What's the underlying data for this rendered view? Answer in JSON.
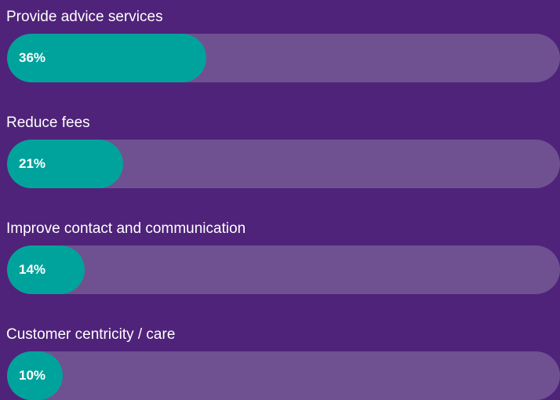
{
  "colors": {
    "background": "#4f237a",
    "track": "#6f5192",
    "bar": "#00a39b",
    "text": "#ffffff"
  },
  "chart_data": {
    "type": "bar",
    "orientation": "horizontal",
    "categories": [
      "Provide advice services",
      "Reduce fees",
      "Improve contact and communication",
      "Customer centricity / care"
    ],
    "values": [
      36,
      21,
      14,
      10
    ],
    "value_labels": [
      "36%",
      "21%",
      "14%",
      "10%"
    ],
    "unit": "%",
    "xlim": [
      0,
      100
    ],
    "grid": false,
    "legend": "none"
  }
}
